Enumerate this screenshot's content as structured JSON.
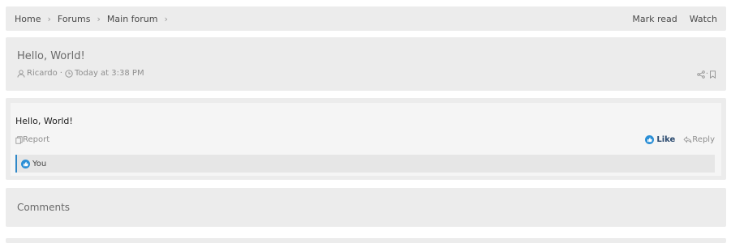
{
  "breadcrumb": {
    "items": [
      "Home",
      "Forums",
      "Main forum"
    ],
    "actions": [
      "Mark read",
      "Watch"
    ]
  },
  "thread": {
    "title": "Hello, World!",
    "author": "Ricardo",
    "date": "Today at 3:38 PM"
  },
  "post": {
    "body": "Hello, World!",
    "report_label": "Report",
    "like_label": "Like",
    "reply_label": "Reply",
    "reaction_user": "You"
  },
  "comments": {
    "title": "Comments"
  },
  "colors": {
    "accent": "#2b8fd6",
    "like_text": "#2b4a6f",
    "panel": "#ececec",
    "post_bg": "#f5f5f5"
  },
  "icons": [
    "user-icon",
    "clock-icon",
    "share-icon",
    "bookmark-icon",
    "report-icon",
    "like-icon",
    "reply-icon"
  ]
}
